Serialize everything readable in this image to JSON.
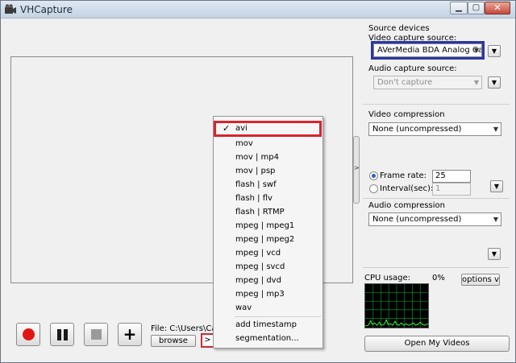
{
  "window": {
    "title": "VHCapture",
    "min_glyph": "▁",
    "max_glyph": "▢",
    "close_glyph": "✕"
  },
  "preview": {
    "splitter_glyph": ">"
  },
  "controls": {
    "add_glyph": "+",
    "file_label": "File: C:\\Users\\Cauptai",
    "browse_label": "browse",
    "more_glyph": ">"
  },
  "format_menu": {
    "check_glyph": "✓",
    "selected": "avi",
    "items": [
      "avi",
      "mov",
      "mov | mp4",
      "mov | psp",
      "flash | swf",
      "flash | flv",
      "flash | RTMP",
      "mpeg | mpeg1",
      "mpeg | mpeg2",
      "mpeg | vcd",
      "mpeg | svcd",
      "mpeg | dvd",
      "mpeg | mp3",
      "wav"
    ],
    "extra_items": [
      "add timestamp",
      "segmentation..."
    ]
  },
  "source_devices": {
    "heading": "Source devices",
    "video_label": "Video capture source:",
    "video_value": "AVerMedia BDA Analog Capture",
    "audio_label": "Audio capture source:",
    "audio_value": "Don't capture"
  },
  "video_compression": {
    "heading": "Video compression",
    "value": "None (uncompressed)",
    "frame_rate_label": "Frame rate:",
    "frame_rate_value": "25",
    "interval_label": "Interval(sec):",
    "interval_value": "1",
    "selected_mode": "frame_rate"
  },
  "audio_compression": {
    "heading": "Audio compression",
    "value": "None (uncompressed)"
  },
  "cpu": {
    "label": "CPU usage:",
    "value": "0%",
    "options_label": "options v"
  },
  "open_videos_label": "Open My Videos",
  "colors": {
    "highlight_red": "#d6252f",
    "highlight_blue": "#2b35a6",
    "record_red": "#e21515",
    "graph_grid": "#0a7d24",
    "graph_line": "#39ff3a"
  },
  "icons": {
    "app": "camera-icon",
    "dropdown": "chevron-down-icon",
    "record": "record-icon",
    "pause": "pause-icon",
    "stop": "stop-icon",
    "add": "plus-icon",
    "check": "check-icon"
  }
}
